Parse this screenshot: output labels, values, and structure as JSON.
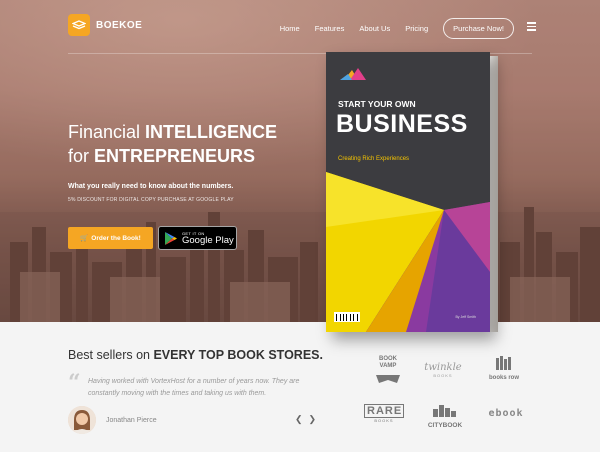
{
  "brand": {
    "name": "BOEKOE"
  },
  "nav": {
    "items": [
      "Home",
      "Features",
      "About Us",
      "Pricing"
    ],
    "cta": "Purchase Now!"
  },
  "hero": {
    "headline_line1_a": "Financial ",
    "headline_line1_b": "INTELLIGENCE",
    "headline_line2_a": "for ",
    "headline_line2_b": "ENTREPRENEURS",
    "subtitle": "What you really need to know about the numbers.",
    "discount": "5% DISCOUNT FOR DIGITAL COPY PURCHASE AT GOOGLE PLAY",
    "order_button": "Order the Book!",
    "gplay_small": "GET IT ON",
    "gplay_big": "Google Play"
  },
  "book": {
    "top": "START YOUR OWN",
    "title": "BUSINESS",
    "tagline": "Creating Rich Experiences",
    "author": "By Jeff Smith"
  },
  "bestsellers": {
    "heading_a": "Best sellers on ",
    "heading_b": "EVERY TOP BOOK STORES."
  },
  "testimonial": {
    "text": "Having worked with VortexHost for a number of years now. They are constantly moving with the times and taking us with them.",
    "author": "Jonathan Pierce"
  },
  "stores": {
    "book_vamp": "BOOK VAMP",
    "twinkle": "twinkle",
    "twinkle_sub": "BOOKS",
    "books_row": "books row",
    "rare": "RARE",
    "rare_sub": "BOOKS",
    "citybook": "CITYBOOK",
    "ebook": "ebook"
  },
  "colors": {
    "accent": "#f5a623",
    "book_dark": "#3c3c40"
  }
}
